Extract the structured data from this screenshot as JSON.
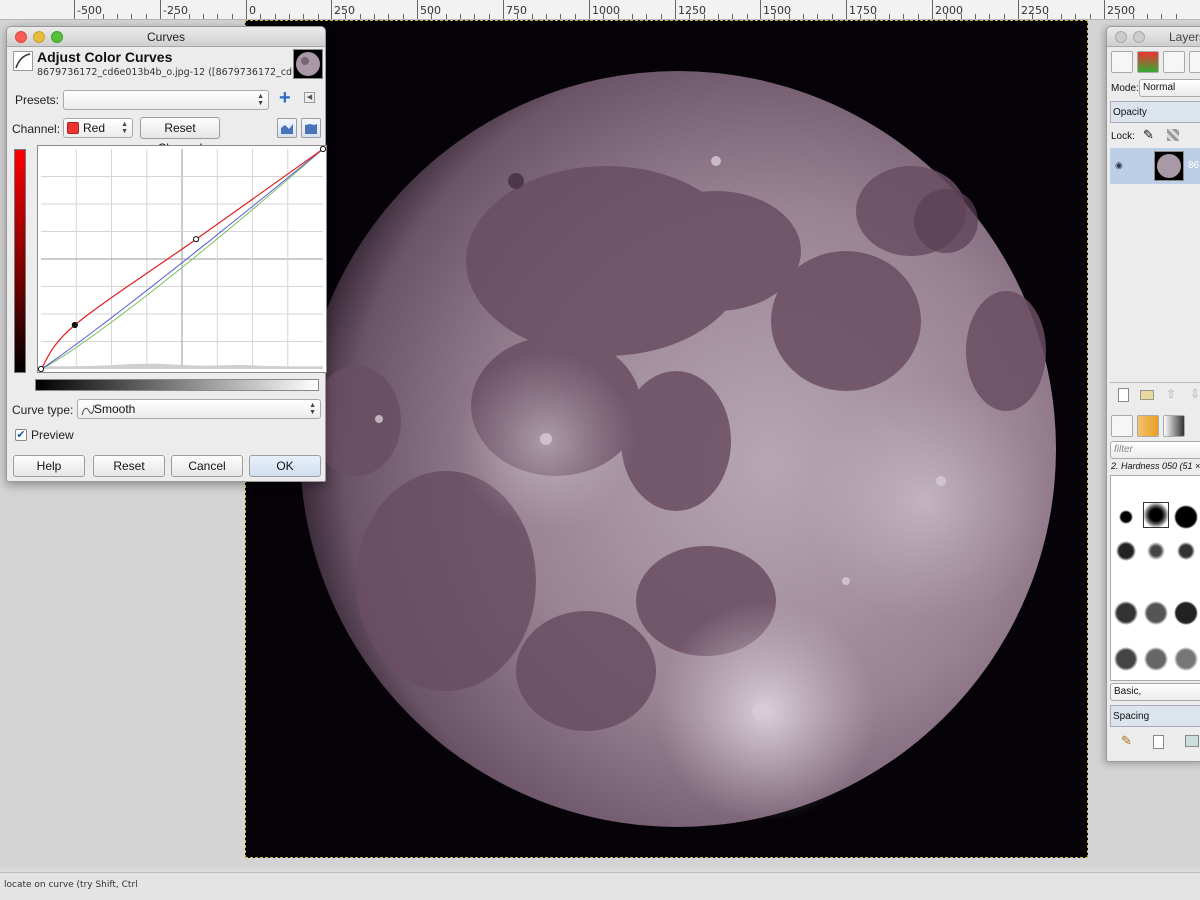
{
  "ruler": {
    "labels": [
      "-500",
      "-250",
      "0",
      "250",
      "500",
      "750",
      "1000",
      "1250",
      "1500",
      "1750",
      "2000",
      "2250",
      "2500"
    ]
  },
  "curves_dialog": {
    "window_title": "Curves",
    "heading": "Adjust Color Curves",
    "subtitle": "8679736172_cd6e013b4b_o.jpg-12 ([8679736172_cd6...",
    "presets_label": "Presets:",
    "presets_value": "",
    "channel_label": "Channel:",
    "channel_value": "Red",
    "reset_channel_label": "Reset Channel",
    "curve_type_label": "Curve type:",
    "curve_type_value": "Smooth",
    "preview_label": "Preview",
    "preview_checked": true,
    "buttons": {
      "help": "Help",
      "reset": "Reset",
      "cancel": "Cancel",
      "ok": "OK"
    },
    "curve_control_points": [
      [
        0,
        0
      ],
      [
        0.12,
        0.2
      ],
      [
        0.55,
        0.59
      ],
      [
        1,
        1
      ]
    ],
    "colors": {
      "red_curve": "#e02020",
      "green_curve": "#7ac060",
      "blue_curve": "#5a5ad8"
    }
  },
  "layers_dock": {
    "title": "Layers",
    "mode_label": "Mode:",
    "mode_value": "Normal",
    "opacity_label": "Opacity",
    "lock_label": "Lock:",
    "layer_name": "86",
    "filter_placeholder": "filter",
    "brush_name": "2. Hardness 050 (51 ×",
    "brush_tag": "Basic,",
    "spacing_label": "Spacing"
  },
  "status_bar": {
    "text": "locate on curve (try Shift, Ctrl"
  },
  "icons": {
    "add_preset": "plus-icon",
    "preset_menu": "triangle-menu-icon",
    "linear_histogram": "linear-histogram-icon",
    "log_histogram": "log-histogram-icon",
    "eye": "eye-icon"
  }
}
